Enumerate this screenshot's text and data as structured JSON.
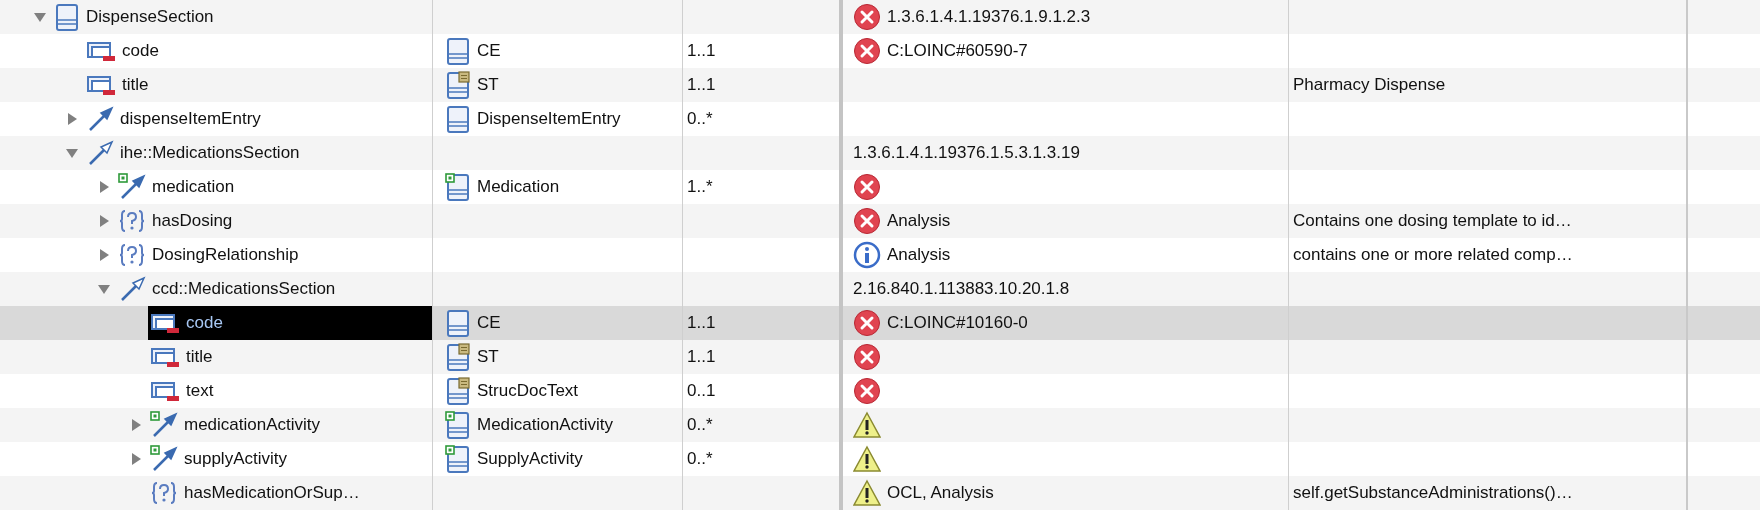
{
  "tree": [
    {
      "name": "DispenseSection",
      "kind": "class",
      "expanded": true,
      "selected": false,
      "status": {
        "kind": "error",
        "text": "1.3.6.1.4.1.19376.1.9.1.2.3"
      },
      "children": [
        {
          "name": "code",
          "kind": "attribute",
          "selected": false,
          "type": {
            "kind": "class",
            "name": "CE"
          },
          "multiplicity": "1..1",
          "status": {
            "kind": "error",
            "text": "C:LOINC#60590-7"
          }
        },
        {
          "name": "title",
          "kind": "attribute",
          "selected": false,
          "type": {
            "kind": "datatype",
            "name": "ST"
          },
          "multiplicity": "1..1",
          "description": "Pharmacy Dispense"
        },
        {
          "name": "dispenseItemEntry",
          "kind": "association",
          "expanded": false,
          "selected": false,
          "type": {
            "kind": "class",
            "name": "DispenseItemEntry"
          },
          "multiplicity": "0..*"
        },
        {
          "name": "ihe::MedicationsSection",
          "kind": "generalization",
          "expanded": true,
          "selected": false,
          "status": {
            "kind": "none",
            "text": "1.3.6.1.4.1.19376.1.5.3.1.3.19"
          },
          "children": [
            {
              "name": "medication",
              "kind": "derived",
              "expanded": false,
              "selected": false,
              "type": {
                "kind": "derived",
                "name": "Medication"
              },
              "multiplicity": "1..*",
              "status": {
                "kind": "error"
              }
            },
            {
              "name": "hasDosing",
              "kind": "constraint",
              "expanded": false,
              "selected": false,
              "status": {
                "kind": "error",
                "text": "Analysis"
              },
              "description": "Contains one dosing template to id…"
            },
            {
              "name": "DosingRelationship",
              "kind": "constraint",
              "expanded": false,
              "selected": false,
              "status": {
                "kind": "info",
                "text": "Analysis"
              },
              "description": "contains one or more related comp…"
            },
            {
              "name": "ccd::MedicationsSection",
              "kind": "generalization",
              "expanded": true,
              "selected": false,
              "status": {
                "kind": "none",
                "text": "2.16.840.1.113883.10.20.1.8"
              },
              "children": [
                {
                  "name": "code",
                  "kind": "attribute",
                  "selected": true,
                  "type": {
                    "kind": "class",
                    "name": "CE"
                  },
                  "multiplicity": "1..1",
                  "status": {
                    "kind": "error",
                    "text": "C:LOINC#10160-0"
                  }
                },
                {
                  "name": "title",
                  "kind": "attribute",
                  "selected": false,
                  "type": {
                    "kind": "datatype",
                    "name": "ST"
                  },
                  "multiplicity": "1..1",
                  "status": {
                    "kind": "error"
                  }
                },
                {
                  "name": "text",
                  "kind": "attribute",
                  "selected": false,
                  "type": {
                    "kind": "datatype",
                    "name": "StrucDocText"
                  },
                  "multiplicity": "0..1",
                  "status": {
                    "kind": "error"
                  }
                },
                {
                  "name": "medicationActivity",
                  "kind": "derived",
                  "expanded": false,
                  "selected": false,
                  "type": {
                    "kind": "derived",
                    "name": "MedicationActivity"
                  },
                  "multiplicity": "0..*",
                  "status": {
                    "kind": "warning"
                  }
                },
                {
                  "name": "supplyActivity",
                  "kind": "derived",
                  "expanded": false,
                  "selected": false,
                  "type": {
                    "kind": "derived",
                    "name": "SupplyActivity"
                  },
                  "multiplicity": "0..*",
                  "status": {
                    "kind": "warning"
                  }
                },
                {
                  "name": "hasMedicationOrSup…",
                  "kind": "constraint",
                  "selected": false,
                  "status": {
                    "kind": "warning",
                    "text": "OCL, Analysis"
                  },
                  "description": "self.getSubstanceAdministrations()…"
                }
              ]
            }
          ]
        }
      ]
    }
  ]
}
